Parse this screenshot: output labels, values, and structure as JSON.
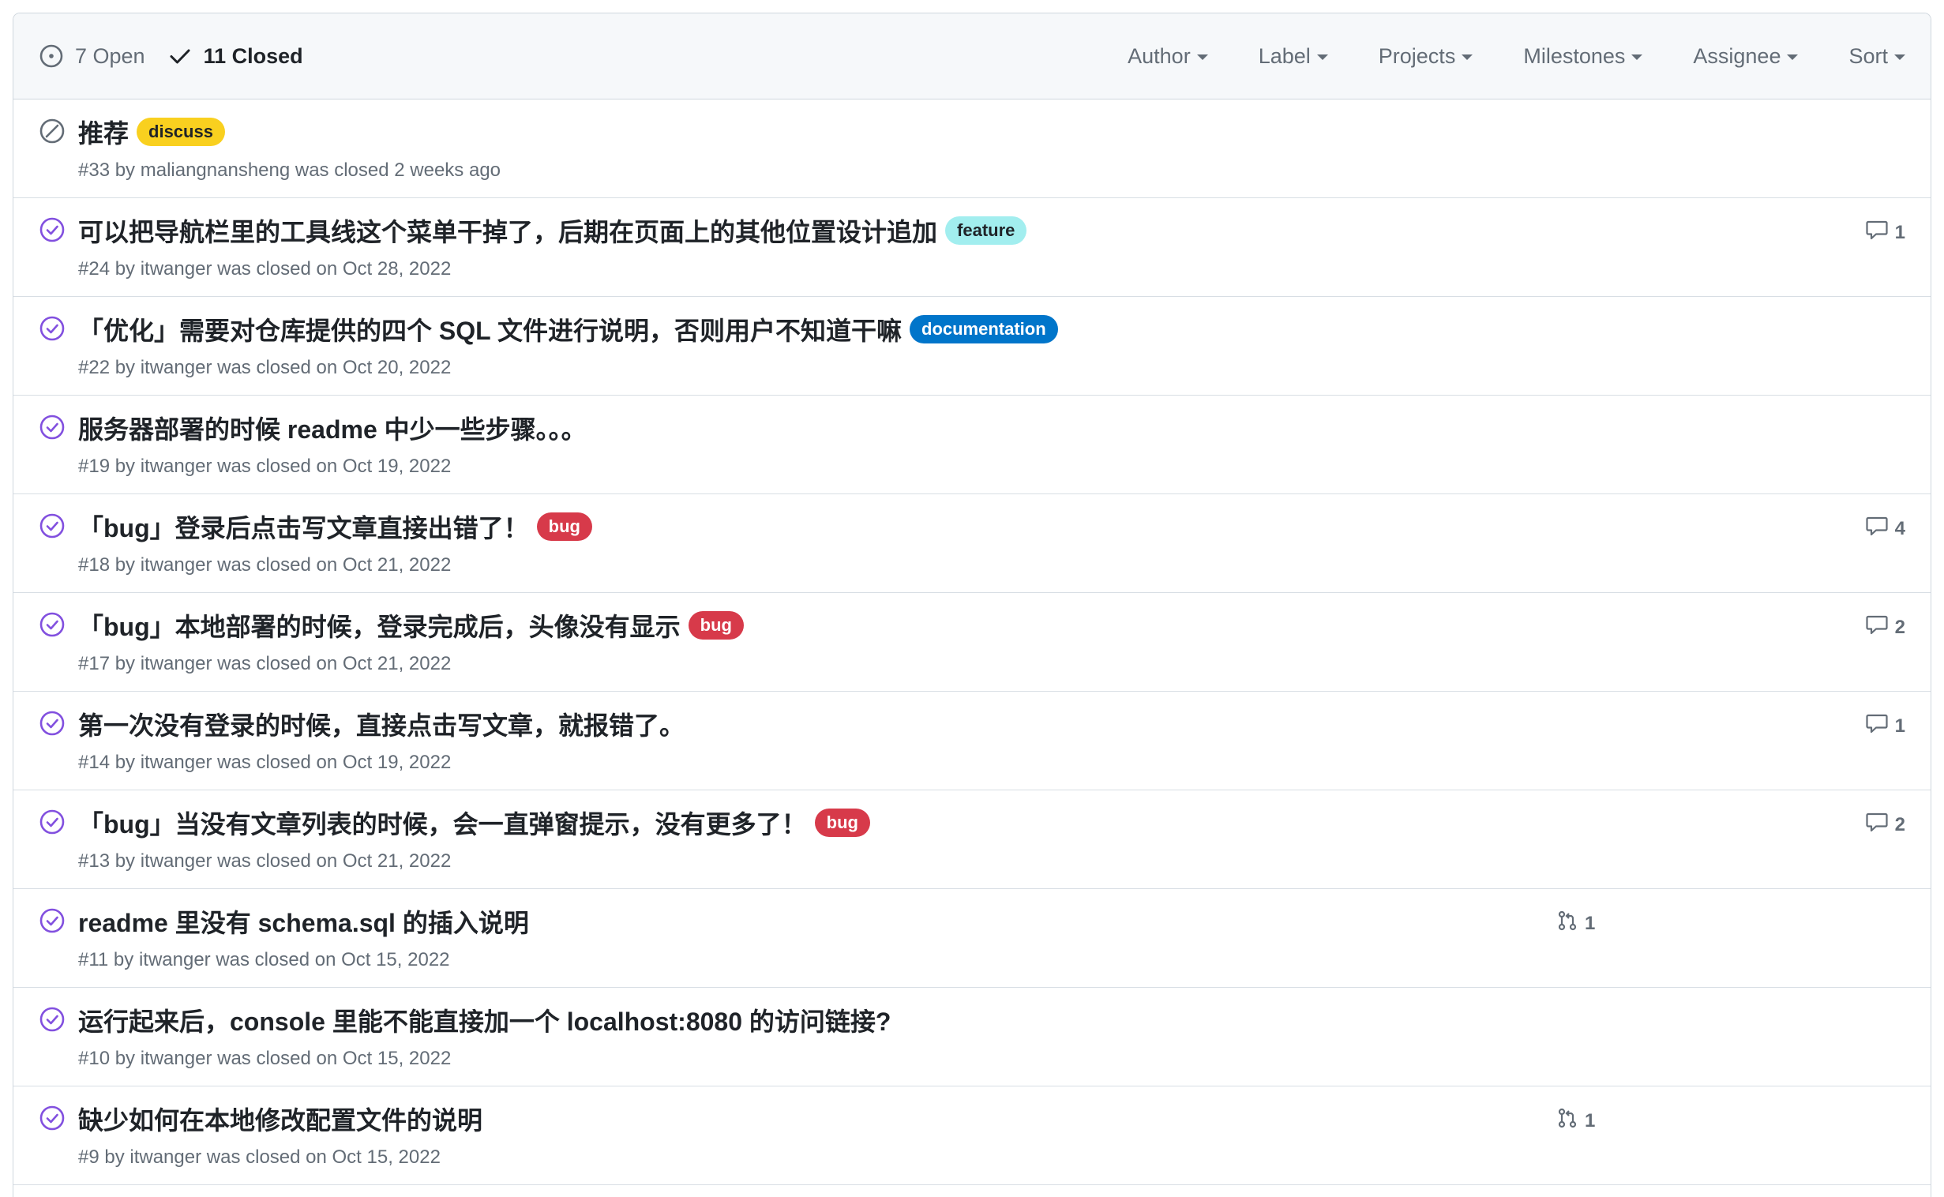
{
  "header": {
    "open_label": "7 Open",
    "closed_label": "11 Closed",
    "filters": [
      "Author",
      "Label",
      "Projects",
      "Milestones",
      "Assignee",
      "Sort"
    ]
  },
  "colors": {
    "closed_completed": "#8250df",
    "closed_not_planned": "#636c76"
  },
  "issues": [
    {
      "title": "推荐",
      "labels": [
        {
          "name": "discuss",
          "bg": "#f9d01f",
          "fg": "#1f2328"
        }
      ],
      "meta": "#33 by maliangnansheng was closed 2 weeks ago",
      "status_icon": "skip-icon",
      "comments": "",
      "linked_prs": ""
    },
    {
      "title": "可以把导航栏里的工具线这个菜单干掉了，后期在页面上的其他位置设计追加",
      "labels": [
        {
          "name": "feature",
          "bg": "#a2eeef",
          "fg": "#1f2328"
        }
      ],
      "meta": "#24 by itwanger was closed on Oct 28, 2022",
      "status_icon": "check-circle-icon",
      "comments": "1",
      "linked_prs": ""
    },
    {
      "title": "「优化」需要对仓库提供的四个 SQL 文件进行说明，否则用户不知道干嘛",
      "labels": [
        {
          "name": "documentation",
          "bg": "#0075ca",
          "fg": "#ffffff"
        }
      ],
      "meta": "#22 by itwanger was closed on Oct 20, 2022",
      "status_icon": "check-circle-icon",
      "comments": "",
      "linked_prs": ""
    },
    {
      "title": "服务器部署的时候 readme 中少一些步骤。。。",
      "labels": [],
      "meta": "#19 by itwanger was closed on Oct 19, 2022",
      "status_icon": "check-circle-icon",
      "comments": "",
      "linked_prs": ""
    },
    {
      "title": "「bug」登录后点击写文章直接出错了！",
      "labels": [
        {
          "name": "bug",
          "bg": "#d73a4a",
          "fg": "#ffffff"
        }
      ],
      "meta": "#18 by itwanger was closed on Oct 21, 2022",
      "status_icon": "check-circle-icon",
      "comments": "4",
      "linked_prs": ""
    },
    {
      "title": "「bug」本地部署的时候，登录完成后，头像没有显示",
      "labels": [
        {
          "name": "bug",
          "bg": "#d73a4a",
          "fg": "#ffffff"
        }
      ],
      "meta": "#17 by itwanger was closed on Oct 21, 2022",
      "status_icon": "check-circle-icon",
      "comments": "2",
      "linked_prs": ""
    },
    {
      "title": "第一次没有登录的时候，直接点击写文章，就报错了。",
      "labels": [],
      "meta": "#14 by itwanger was closed on Oct 19, 2022",
      "status_icon": "check-circle-icon",
      "comments": "1",
      "linked_prs": ""
    },
    {
      "title": "「bug」当没有文章列表的时候，会一直弹窗提示，没有更多了！",
      "labels": [
        {
          "name": "bug",
          "bg": "#d73a4a",
          "fg": "#ffffff"
        }
      ],
      "meta": "#13 by itwanger was closed on Oct 21, 2022",
      "status_icon": "check-circle-icon",
      "comments": "2",
      "linked_prs": ""
    },
    {
      "title": "readme 里没有 schema.sql 的插入说明",
      "labels": [],
      "meta": "#11 by itwanger was closed on Oct 15, 2022",
      "status_icon": "check-circle-icon",
      "comments": "",
      "linked_prs": "1"
    },
    {
      "title": "运行起来后，console 里能不能直接加一个 localhost:8080 的访问链接?",
      "labels": [],
      "meta": "#10 by itwanger was closed on Oct 15, 2022",
      "status_icon": "check-circle-icon",
      "comments": "",
      "linked_prs": ""
    },
    {
      "title": "缺少如何在本地修改配置文件的说明",
      "labels": [],
      "meta": "#9 by itwanger was closed on Oct 15, 2022",
      "status_icon": "check-circle-icon",
      "comments": "",
      "linked_prs": "1"
    }
  ]
}
